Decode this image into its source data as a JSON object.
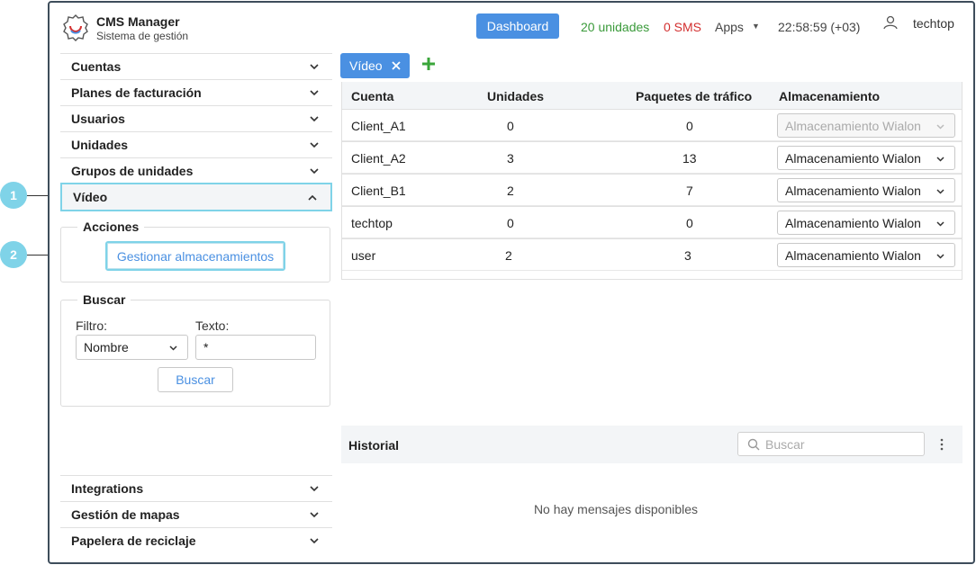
{
  "header": {
    "app_title": "CMS Manager",
    "app_subtitle": "Sistema de gestión",
    "dashboard_label": "Dashboard",
    "units_label": "20 unidades",
    "sms_label": "0 SMS",
    "apps_label": "Apps",
    "clock": "22:58:59 (+03)",
    "username": "techtop"
  },
  "sidebar": {
    "items": [
      {
        "label": "Cuentas"
      },
      {
        "label": "Planes de facturación"
      },
      {
        "label": "Usuarios"
      },
      {
        "label": "Unidades"
      },
      {
        "label": "Grupos de unidades"
      },
      {
        "label": "Vídeo"
      },
      {
        "label": "Integrations"
      },
      {
        "label": "Gestión de mapas"
      },
      {
        "label": "Papelera de reciclaje"
      }
    ],
    "actions_legend": "Acciones",
    "manage_storage_label": "Gestionar almacenamientos",
    "search_legend": "Buscar",
    "filter_label": "Filtro:",
    "filter_value": "Nombre",
    "text_label": "Texto:",
    "text_value": "*",
    "search_button": "Buscar"
  },
  "tabs": [
    {
      "label": "Vídeo"
    }
  ],
  "table": {
    "headers": [
      "Cuenta",
      "Unidades",
      "Paquetes de tráfico",
      "Almacenamiento"
    ],
    "rows": [
      {
        "account": "Client_A1",
        "units": "0",
        "traffic": "0",
        "storage": "Almacenamiento Wialon",
        "disabled": true
      },
      {
        "account": "Client_A2",
        "units": "3",
        "traffic": "13",
        "storage": "Almacenamiento Wialon",
        "disabled": false
      },
      {
        "account": "Client_B1",
        "units": "2",
        "traffic": "7",
        "storage": "Almacenamiento Wialon",
        "disabled": false
      },
      {
        "account": "techtop",
        "units": "0",
        "traffic": "0",
        "storage": "Almacenamiento Wialon",
        "disabled": false
      },
      {
        "account": "user",
        "units": "2",
        "traffic": "3",
        "storage": "Almacenamiento Wialon",
        "disabled": false
      }
    ]
  },
  "history": {
    "title": "Historial",
    "search_placeholder": "Buscar",
    "empty_message": "No hay mensajes disponibles"
  },
  "callouts": [
    "1",
    "2"
  ],
  "colors": {
    "accent": "#4a90e2",
    "units_green": "#3a9a3a",
    "sms_red": "#d32f2f",
    "callout": "#7fd3e8",
    "add_green": "#3aa63a"
  }
}
